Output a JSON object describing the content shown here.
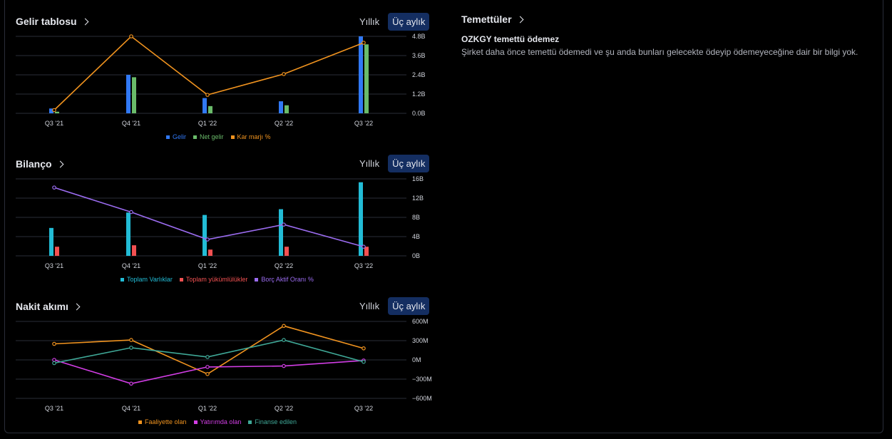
{
  "toggle": {
    "annual": "Yıllık",
    "quarterly": "Üç aylık"
  },
  "income": {
    "title": "Gelir tablosu",
    "colors": {
      "rev": "#3179f5",
      "net": "#6abb6a",
      "margin": "#f0931f"
    }
  },
  "balance": {
    "title": "Bilanço",
    "colors": {
      "assets": "#22bcd6",
      "liab": "#f25152",
      "ratio": "#9b6cf0"
    }
  },
  "cashflow": {
    "title": "Nakit akımı",
    "colors": {
      "op": "#f0931f",
      "inv": "#d33ee6",
      "fin": "#3fa897"
    }
  },
  "dividends": {
    "title": "Temettüler",
    "headline": "OZKGY temettü ödemez",
    "text": "Şirket daha önce temettü ödemedi ve şu anda bunları gelecekte ödeyip ödemeyeceğine dair bir bilgi yok."
  },
  "chart_data": [
    {
      "type": "bar",
      "title": "Gelir tablosu",
      "categories": [
        "Q3 '21",
        "Q4 '21",
        "Q1 '22",
        "Q2 '22",
        "Q3 '22"
      ],
      "y_ticks": [
        "0.0B",
        "1.2B",
        "2.4B",
        "3.6B",
        "4.8B"
      ],
      "ylim": [
        0,
        4.8
      ],
      "series": [
        {
          "name": "Gelir",
          "type": "bar",
          "values": [
            0.3,
            2.4,
            0.95,
            0.75,
            4.8
          ]
        },
        {
          "name": "Net gelir",
          "type": "bar",
          "values": [
            0.1,
            2.25,
            0.45,
            0.5,
            4.3
          ]
        },
        {
          "name": "Kar marjı %",
          "type": "line",
          "values": [
            0.2,
            4.8,
            1.15,
            2.45,
            4.4
          ]
        }
      ]
    },
    {
      "type": "bar",
      "title": "Bilanço",
      "categories": [
        "Q3 '21",
        "Q4 '21",
        "Q1 '22",
        "Q2 '22",
        "Q3 '22"
      ],
      "y_ticks": [
        "0B",
        "4B",
        "8B",
        "12B",
        "16B"
      ],
      "ylim": [
        0,
        16
      ],
      "series": [
        {
          "name": "Toplam Varlıklar",
          "type": "bar",
          "values": [
            5.8,
            9.0,
            8.5,
            9.7,
            15.3
          ]
        },
        {
          "name": "Toplam yükümlülükler",
          "type": "bar",
          "values": [
            1.9,
            2.2,
            1.3,
            1.9,
            1.9
          ]
        },
        {
          "name": "Borç Aktif Oranı %",
          "type": "line",
          "values": [
            14.2,
            9.1,
            3.4,
            6.5,
            1.9
          ]
        }
      ]
    },
    {
      "type": "line",
      "title": "Nakit akımı",
      "categories": [
        "Q3 '21",
        "Q4 '21",
        "Q1 '22",
        "Q2 '22",
        "Q3 '22"
      ],
      "y_ticks": [
        "600M",
        "300M",
        "0M",
        "−300M",
        "−600M"
      ],
      "ylim": [
        -600,
        600
      ],
      "series": [
        {
          "name": "Faaliyette olan",
          "type": "line",
          "values": [
            250,
            310,
            -220,
            530,
            180
          ]
        },
        {
          "name": "Yatırımda olan",
          "type": "line",
          "values": [
            0,
            -370,
            -110,
            -95,
            -10
          ]
        },
        {
          "name": "Finanse edilen",
          "type": "line",
          "values": [
            -50,
            190,
            45,
            310,
            -30
          ]
        }
      ]
    }
  ]
}
